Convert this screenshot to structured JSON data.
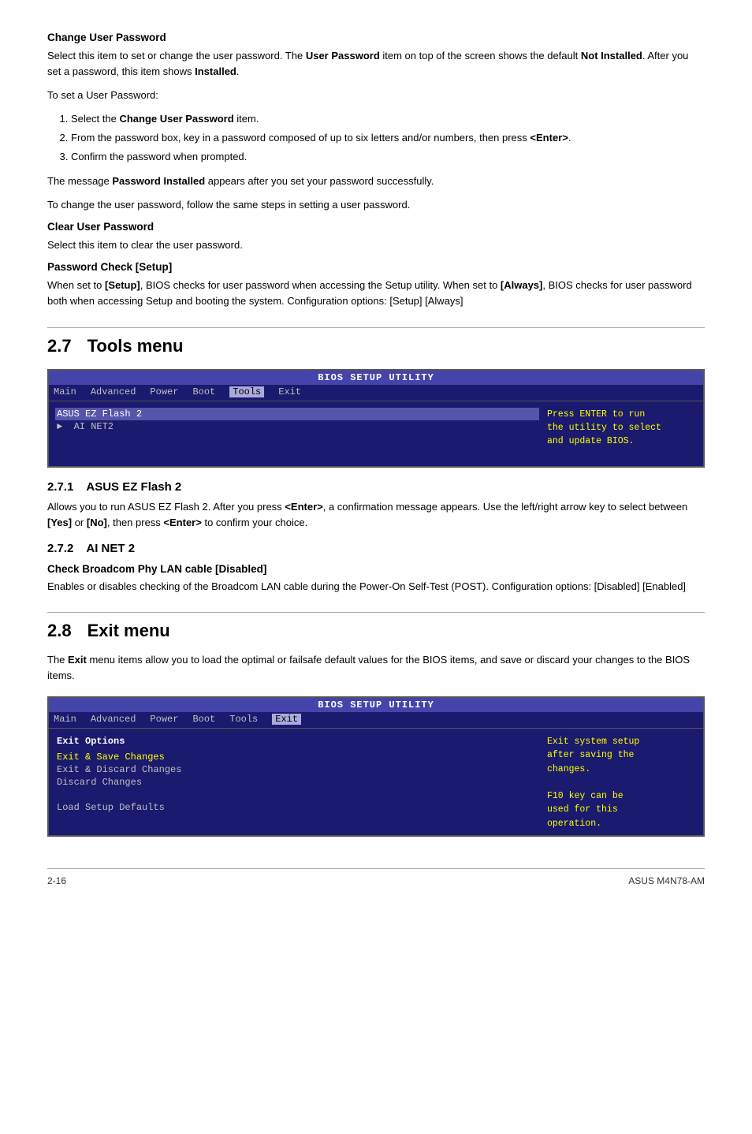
{
  "page": {
    "footer_left": "2-16",
    "footer_right": "ASUS M4N78-AM"
  },
  "change_user_password": {
    "heading": "Change User Password",
    "para1": "Select this item to set or change the user password. The ",
    "bold1": "User Password",
    "para1b": " item on top of the screen shows the default ",
    "bold2": "Not Installed",
    "para1c": ". After you set a password, this item shows ",
    "bold3": "Installed",
    "para1d": ".",
    "para2": "To set a User Password:",
    "step1": "Select the ",
    "step1b": "Change User Password",
    "step1c": " item.",
    "step2": "From the password box, key in a password composed of up to six letters and/or numbers, then press ",
    "step2b": "<Enter>",
    "step2c": ".",
    "step3": "Confirm the password when prompted.",
    "para3_pre": "The message ",
    "para3_bold": "Password Installed",
    "para3_post": " appears after you set your password successfully.",
    "para4": "To change the user password, follow the same steps in setting a user password."
  },
  "clear_user_password": {
    "heading": "Clear User Password",
    "para1": "Select this item to clear the user password."
  },
  "password_check": {
    "heading": "Password Check [Setup]",
    "para1": "When set to ",
    "bold1": "[Setup]",
    "para1b": ", BIOS checks for user password when accessing the Setup utility. When set to ",
    "bold2": "[Always]",
    "para1c": ", BIOS checks for user password both when accessing Setup and booting the system. Configuration options: [Setup] [Always]"
  },
  "tools_menu": {
    "section_num": "2.7",
    "section_title": "Tools menu",
    "bios": {
      "titlebar": "BIOS SETUP UTILITY",
      "menu_items": [
        "Main",
        "Advanced",
        "Power",
        "Boot",
        "Tools",
        "Exit"
      ],
      "active_menu": "Tools",
      "left_items": [
        {
          "text": "ASUS EZ Flash 2",
          "type": "label"
        },
        {
          "text": "  ▶  AI NET2",
          "type": "item"
        }
      ],
      "right_text": "Press ENTER to run\nthe utility to select\nand update BIOS."
    }
  },
  "asus_ez_flash": {
    "section_num": "2.7.1",
    "section_title": "ASUS EZ Flash 2",
    "para1": "Allows you to run ASUS EZ Flash 2. After you press ",
    "bold1": "<Enter>",
    "para1b": ", a confirmation message appears. Use the left/right arrow key to select between ",
    "bold2": "[Yes]",
    "para1c": " or ",
    "bold3": "[No]",
    "para1d": ", then press ",
    "bold4": "<Enter>",
    "para1e": " to confirm your choice."
  },
  "ai_net2": {
    "section_num": "2.7.2",
    "section_title": "AI NET 2",
    "sub_heading": "Check Broadcom Phy LAN cable [Disabled]",
    "para1": "Enables or disables checking of the Broadcom LAN cable during the Power-On Self-Test (POST). Configuration options: [Disabled] [Enabled]"
  },
  "exit_menu": {
    "section_num": "2.8",
    "section_title": "Exit menu",
    "para1": "The ",
    "bold1": "Exit",
    "para1b": " menu items allow you to load the optimal or failsafe default values for the BIOS items, and save or discard your changes to the BIOS items.",
    "bios": {
      "titlebar": "BIOS SETUP UTILITY",
      "menu_items": [
        "Main",
        "Advanced",
        "Power",
        "Boot",
        "Tools",
        "Exit"
      ],
      "active_menu": "Exit",
      "left_header": "Exit Options",
      "left_items": [
        {
          "text": "Exit & Save Changes",
          "type": "yellow"
        },
        {
          "text": "Exit & Discard Changes",
          "type": "normal"
        },
        {
          "text": "Discard Changes",
          "type": "normal"
        },
        {
          "text": "",
          "type": "spacer"
        },
        {
          "text": "Load Setup Defaults",
          "type": "normal"
        }
      ],
      "right_text": "Exit system setup\nafter saving the\nchanges.\n\nF10 key can be\nused for this\noperation."
    }
  }
}
